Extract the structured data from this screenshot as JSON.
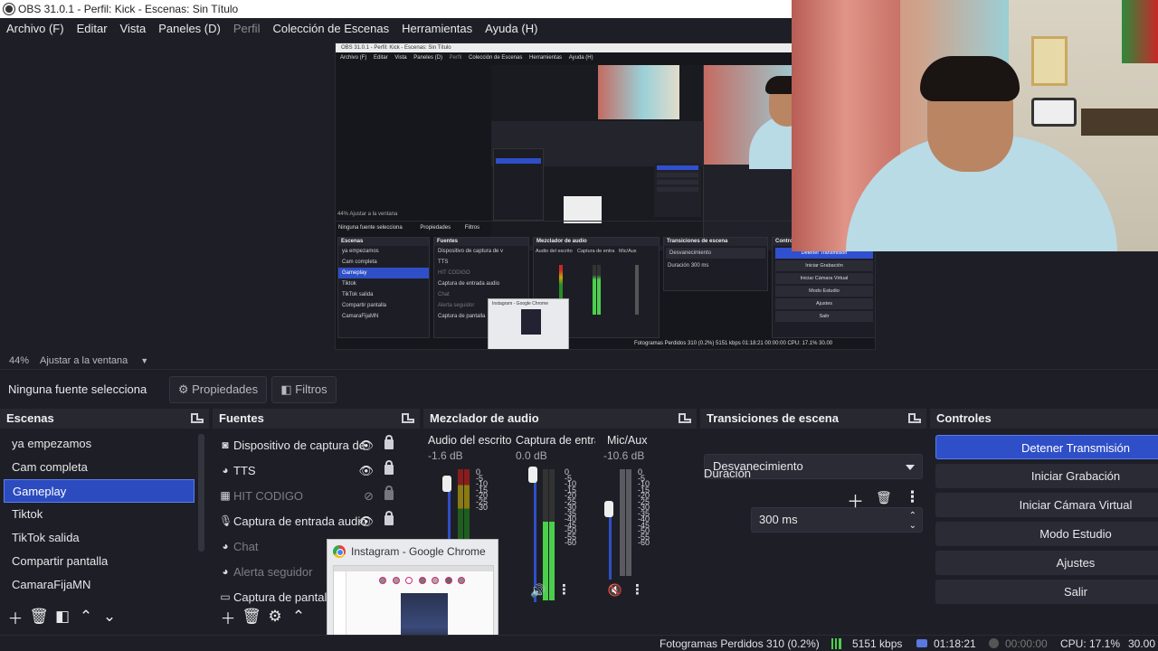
{
  "window": {
    "title": "OBS 31.0.1 - Perfil: Kick - Escenas: Sin Título"
  },
  "menu": [
    {
      "label": "Archivo (F)",
      "enabled": true
    },
    {
      "label": "Editar",
      "enabled": true
    },
    {
      "label": "Vista",
      "enabled": true
    },
    {
      "label": "Paneles (D)",
      "enabled": true
    },
    {
      "label": "Perfil",
      "enabled": false
    },
    {
      "label": "Colección de Escenas",
      "enabled": true
    },
    {
      "label": "Herramientas",
      "enabled": true
    },
    {
      "label": "Ayuda (H)",
      "enabled": true
    }
  ],
  "zoom": {
    "percent": "44%",
    "mode": "Ajustar a la ventana"
  },
  "source_toolbar": {
    "label": "Ninguna fuente selecciona",
    "properties": "Propiedades",
    "filters": "Filtros"
  },
  "scenes": {
    "title": "Escenas",
    "items": [
      "ya empezamos",
      "Cam completa",
      "Gameplay",
      "Tiktok",
      "TikTok salida",
      "Compartir pantalla",
      "CamaraFijaMN"
    ],
    "selected_index": 2
  },
  "sources": {
    "title": "Fuentes",
    "items": [
      {
        "label": "Dispositivo de captura de v",
        "icon": "camera-icon",
        "visible": true,
        "dim": false
      },
      {
        "label": "TTS",
        "icon": "globe-icon",
        "visible": true,
        "dim": false
      },
      {
        "label": "HIT CODIGO",
        "icon": "grid-icon",
        "visible": false,
        "dim": true
      },
      {
        "label": "Captura de entrada audio",
        "icon": "microphone-icon",
        "visible": true,
        "dim": false
      },
      {
        "label": "Chat",
        "icon": "globe-icon",
        "visible": true,
        "dim": true
      },
      {
        "label": "Alerta seguidor",
        "icon": "globe-icon",
        "visible": true,
        "dim": true
      },
      {
        "label": "Captura de pantalla",
        "icon": "monitor-icon",
        "visible": true,
        "dim": false
      }
    ]
  },
  "mixer": {
    "title": "Mezclador de audio",
    "channels": [
      {
        "name": "Audio del escrito",
        "db": "-1.6 dB",
        "level": 0.55
      },
      {
        "name": "Captura de entra",
        "db": "0.0 dB",
        "level": 0.95
      },
      {
        "name": "Mic/Aux",
        "db": "-10.6 dB",
        "level": 0.55
      }
    ],
    "ticks": [
      "0",
      "-5",
      "-10",
      "-15",
      "-20",
      "-25",
      "-30",
      "-35",
      "-40",
      "-45",
      "-50",
      "-55",
      "-60"
    ]
  },
  "transitions": {
    "title": "Transiciones de escena",
    "selected": "Desvanecimiento",
    "duration_label": "Duración",
    "duration_value": "300 ms"
  },
  "controls": {
    "title": "Controles",
    "buttons": [
      "Detener Transmisión",
      "Iniciar Grabación",
      "Iniciar Cámara Virtual",
      "Modo Estudio",
      "Ajustes",
      "Salir"
    ]
  },
  "chrome_popup": {
    "title": "Instagram - Google Chrome"
  },
  "status": {
    "dropped": "Fotogramas Perdidos 310 (0.2%)",
    "bitrate": "5151 kbps",
    "live_time": "01:18:21",
    "rec_time": "00:00:00",
    "cpu": "CPU: 17.1%",
    "fps": "30.00"
  },
  "nested": {
    "title": "OBS 31.0.1 - Perfil: Kick - Escenas: Sin Título",
    "menu": [
      "Archivo (F)",
      "Editar",
      "Vista",
      "Paneles (D)",
      "Perfil",
      "Colección de Escenas",
      "Herramientas",
      "Ayuda (H)"
    ],
    "zoom": "44%  Ajustar a la ventana",
    "source_label": "Ninguna fuente selecciona",
    "status": "Fotogramas Perdidos 310 (0.2%)   5151 kbps   01:18:21   00:00:00   CPU: 17.1%   30.00"
  },
  "colors": {
    "background": "#1e1f26",
    "accent": "#2f4fc8",
    "meter_green": "#4ccf4c",
    "meter_red": "#c62828"
  }
}
